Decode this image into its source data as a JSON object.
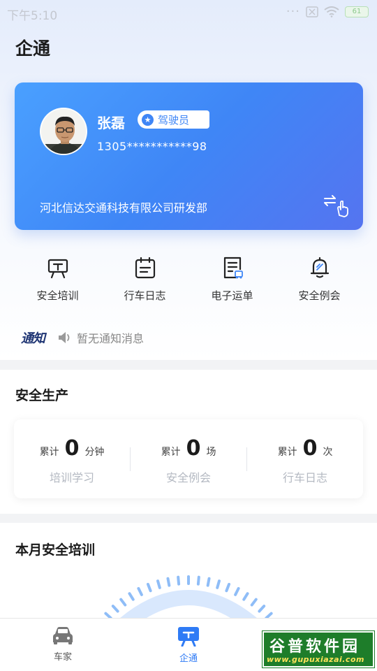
{
  "status_bar": {
    "time": "下午5:10",
    "battery": "61"
  },
  "page_title": "企通",
  "profile": {
    "name": "张磊",
    "role": "驾驶员",
    "phone": "1305***********98",
    "company": "河北信达交通科技有限公司研发部"
  },
  "quick_actions": [
    {
      "label": "安全培训",
      "icon": "training-board-icon"
    },
    {
      "label": "行车日志",
      "icon": "calendar-log-icon"
    },
    {
      "label": "电子运单",
      "icon": "waybill-doc-icon"
    },
    {
      "label": "安全例会",
      "icon": "bell-meeting-icon"
    }
  ],
  "notice": {
    "logo": "通知",
    "text": "暂无通知消息"
  },
  "safety_production": {
    "title": "安全生产",
    "stats": [
      {
        "prefix": "累计",
        "value": "0",
        "unit": "分钟",
        "label": "培训学习"
      },
      {
        "prefix": "累计",
        "value": "0",
        "unit": "场",
        "label": "安全例会"
      },
      {
        "prefix": "累计",
        "value": "0",
        "unit": "次",
        "label": "行车日志"
      }
    ]
  },
  "monthly_training": {
    "title": "本月安全培训"
  },
  "bottom_nav": [
    {
      "label": "车家",
      "icon": "car-icon",
      "active": false
    },
    {
      "label": "企通",
      "icon": "enterprise-chat-icon",
      "active": true
    }
  ],
  "watermark": {
    "title": "谷普软件园",
    "url": "www.gupuxiazai.com"
  },
  "colors": {
    "accent": "#3f86f6",
    "card_gradient_start": "#4aa0ff",
    "card_gradient_end": "#5574f0"
  }
}
